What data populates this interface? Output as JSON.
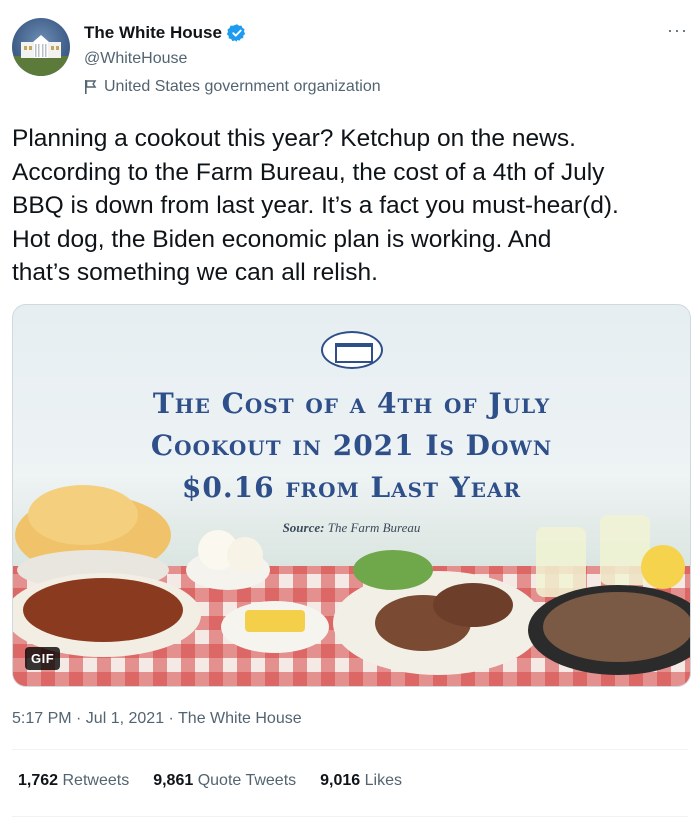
{
  "author": {
    "display_name": "The White House",
    "handle": "@WhiteHouse",
    "org_label": "United States government organization",
    "verified_color": "#1d9bf0"
  },
  "tweet": {
    "text": "Planning a cookout this year? Ketchup on the news.\nAccording to the Farm Bureau, the cost of a 4th of July\nBBQ is down from last year. It’s a fact you must-hear(d).\nHot dog, the Biden economic plan is working. And\nthat’s something we can all relish."
  },
  "media": {
    "headline_line1": "The Cost of a 4th of July",
    "headline_line2": "Cookout in 2021 Is Down",
    "headline_line3": "$0.16 from Last Year",
    "source_label": "Source:",
    "source_value": "The Farm Bureau",
    "badge": "GIF",
    "headline_color": "#2e4f8a"
  },
  "meta": {
    "timestamp": "5:17 PM · Jul 1, 2021 · The White House"
  },
  "stats": {
    "retweets_count": "1,762",
    "retweets_label": "Retweets",
    "quotes_count": "9,861",
    "quotes_label": "Quote Tweets",
    "likes_count": "9,016",
    "likes_label": "Likes"
  }
}
